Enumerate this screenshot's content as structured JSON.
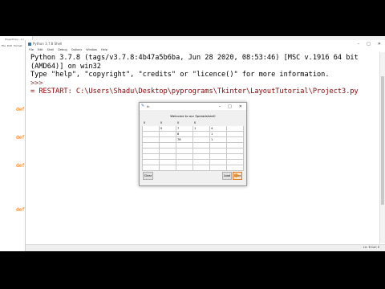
{
  "editor": {
    "title": "Project3.py - C:/",
    "menu": [
      "File",
      "Edit",
      "Format",
      "Run",
      "Options"
    ],
    "keywords": [
      "def",
      "def",
      "def",
      "def"
    ]
  },
  "shell": {
    "title": "Python 3.7.8 Shell",
    "window_controls": [
      "–",
      "□",
      "✕"
    ],
    "menu": [
      "File",
      "Edit",
      "Shell",
      "Debug",
      "Options",
      "Window",
      "Help"
    ],
    "lines": [
      "Python 3.7.8 (tags/v3.7.8:4b47a5b6ba, Jun 28 2020, 08:53:46) [MSC v.1916 64 bit",
      "(AMD64)] on win32",
      "Type \"help\", \"copyright\", \"credits\" or \"licence()\" for more information.",
      ">>>",
      "= RESTART: C:\\Users\\Shadu\\Desktop\\pyprograms\\Tkinter\\LayoutTutorial\\Project3.py"
    ],
    "status": "Ln: 6  Col: 0"
  },
  "tk_window": {
    "title": "tk",
    "window_controls": [
      "–",
      "□",
      "✕"
    ],
    "heading": "Welcome to our Spreadsheet!",
    "header_row": [
      "0",
      "0",
      "0",
      "0"
    ],
    "rows": [
      [
        "",
        "0",
        "7",
        "1",
        "4",
        ""
      ],
      [
        "",
        "",
        "8",
        "",
        "1",
        ""
      ],
      [
        "",
        "",
        "78",
        "",
        "1",
        ""
      ],
      [
        "",
        "",
        "",
        "",
        "",
        ""
      ],
      [
        "",
        "",
        "",
        "",
        "",
        ""
      ],
      [
        "",
        "",
        "",
        "",
        "",
        ""
      ],
      [
        "",
        "",
        "",
        "",
        "",
        ""
      ],
      [
        "",
        "",
        "",
        "",
        "",
        ""
      ]
    ],
    "buttons": {
      "clear": "Clear",
      "load": "Load",
      "save": "Save"
    }
  }
}
